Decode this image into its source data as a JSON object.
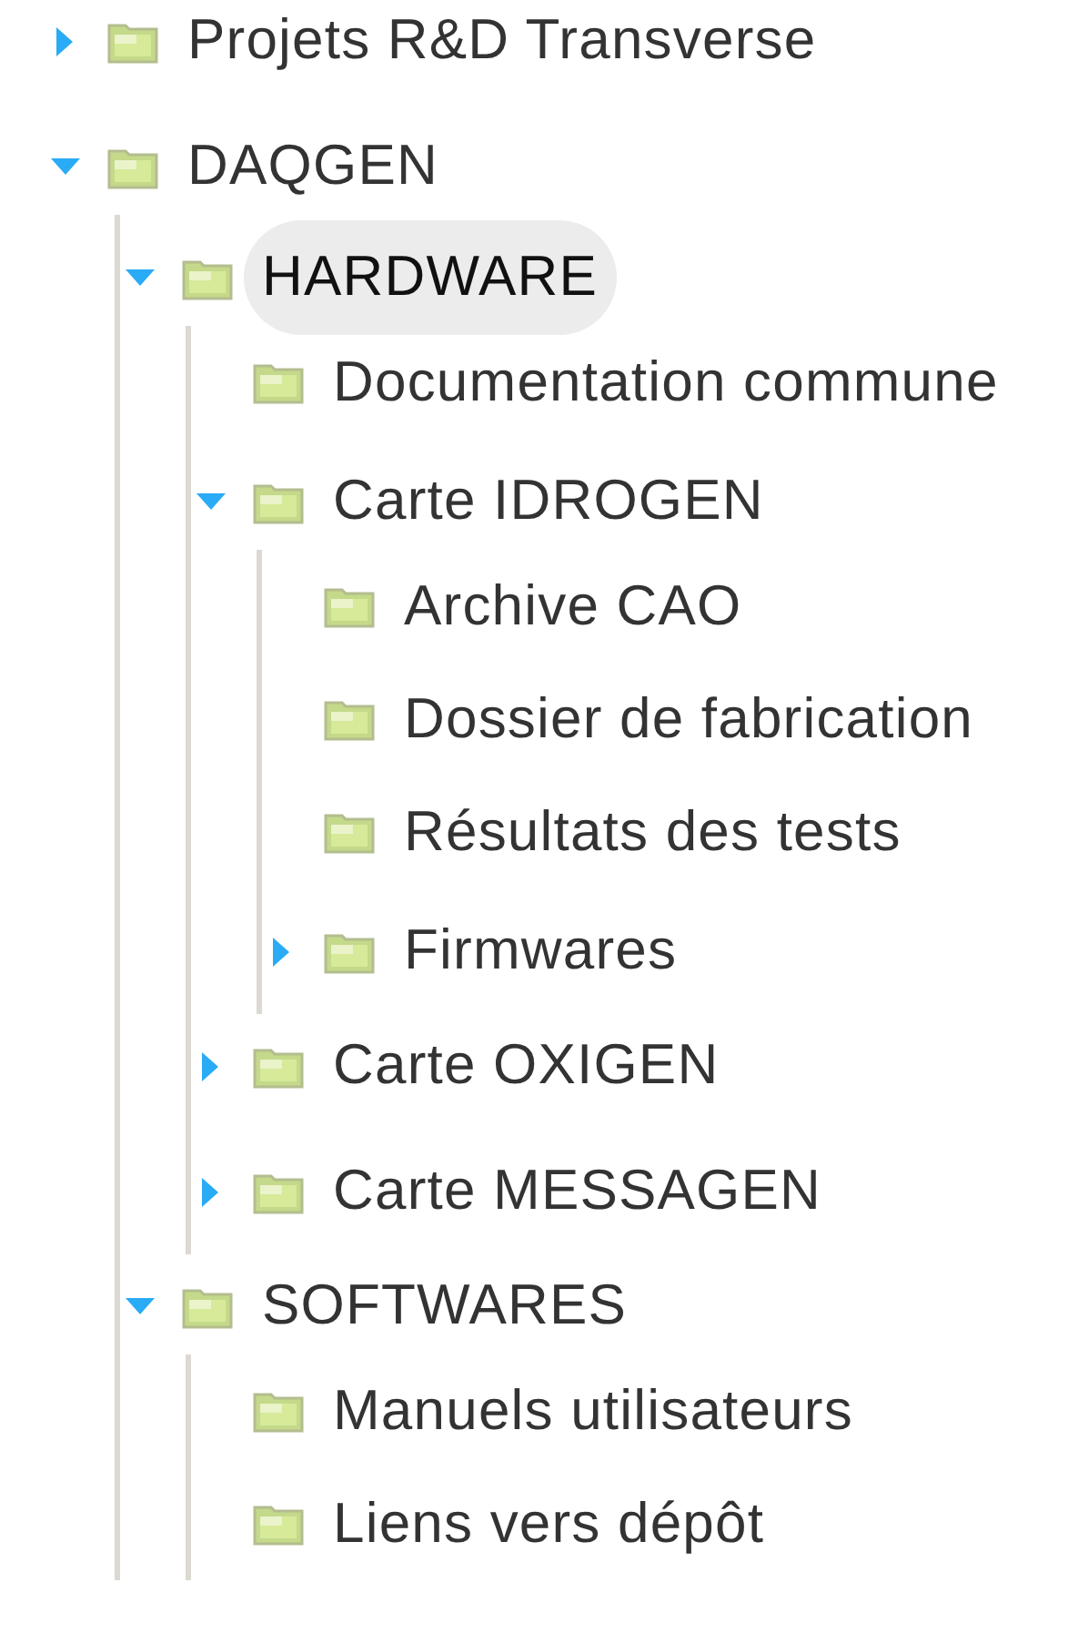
{
  "tree": [
    {
      "label": "Projets R&D Transverse",
      "expanded": false,
      "selected": false,
      "has_children": true
    },
    {
      "label": "DAQGEN",
      "expanded": true,
      "selected": false,
      "has_children": true,
      "children": [
        {
          "label": "HARDWARE",
          "expanded": true,
          "selected": true,
          "has_children": true,
          "children": [
            {
              "label": "Documentation commune",
              "selected": false,
              "has_children": false
            },
            {
              "label": "Carte IDROGEN",
              "expanded": true,
              "selected": false,
              "has_children": true,
              "children": [
                {
                  "label": "Archive CAO",
                  "selected": false,
                  "has_children": false
                },
                {
                  "label": "Dossier de fabrication",
                  "selected": false,
                  "has_children": false
                },
                {
                  "label": "Résultats des tests",
                  "selected": false,
                  "has_children": false
                },
                {
                  "label": "Firmwares",
                  "expanded": false,
                  "selected": false,
                  "has_children": true
                }
              ]
            },
            {
              "label": "Carte OXIGEN",
              "expanded": false,
              "selected": false,
              "has_children": true
            },
            {
              "label": "Carte MESSAGEN",
              "expanded": false,
              "selected": false,
              "has_children": true
            }
          ]
        },
        {
          "label": "SOFTWARES",
          "expanded": true,
          "selected": false,
          "has_children": true,
          "children": [
            {
              "label": "Manuels utilisateurs",
              "selected": false,
              "has_children": false
            },
            {
              "label": "Liens vers dépôt",
              "selected": false,
              "has_children": false
            }
          ]
        }
      ]
    }
  ]
}
